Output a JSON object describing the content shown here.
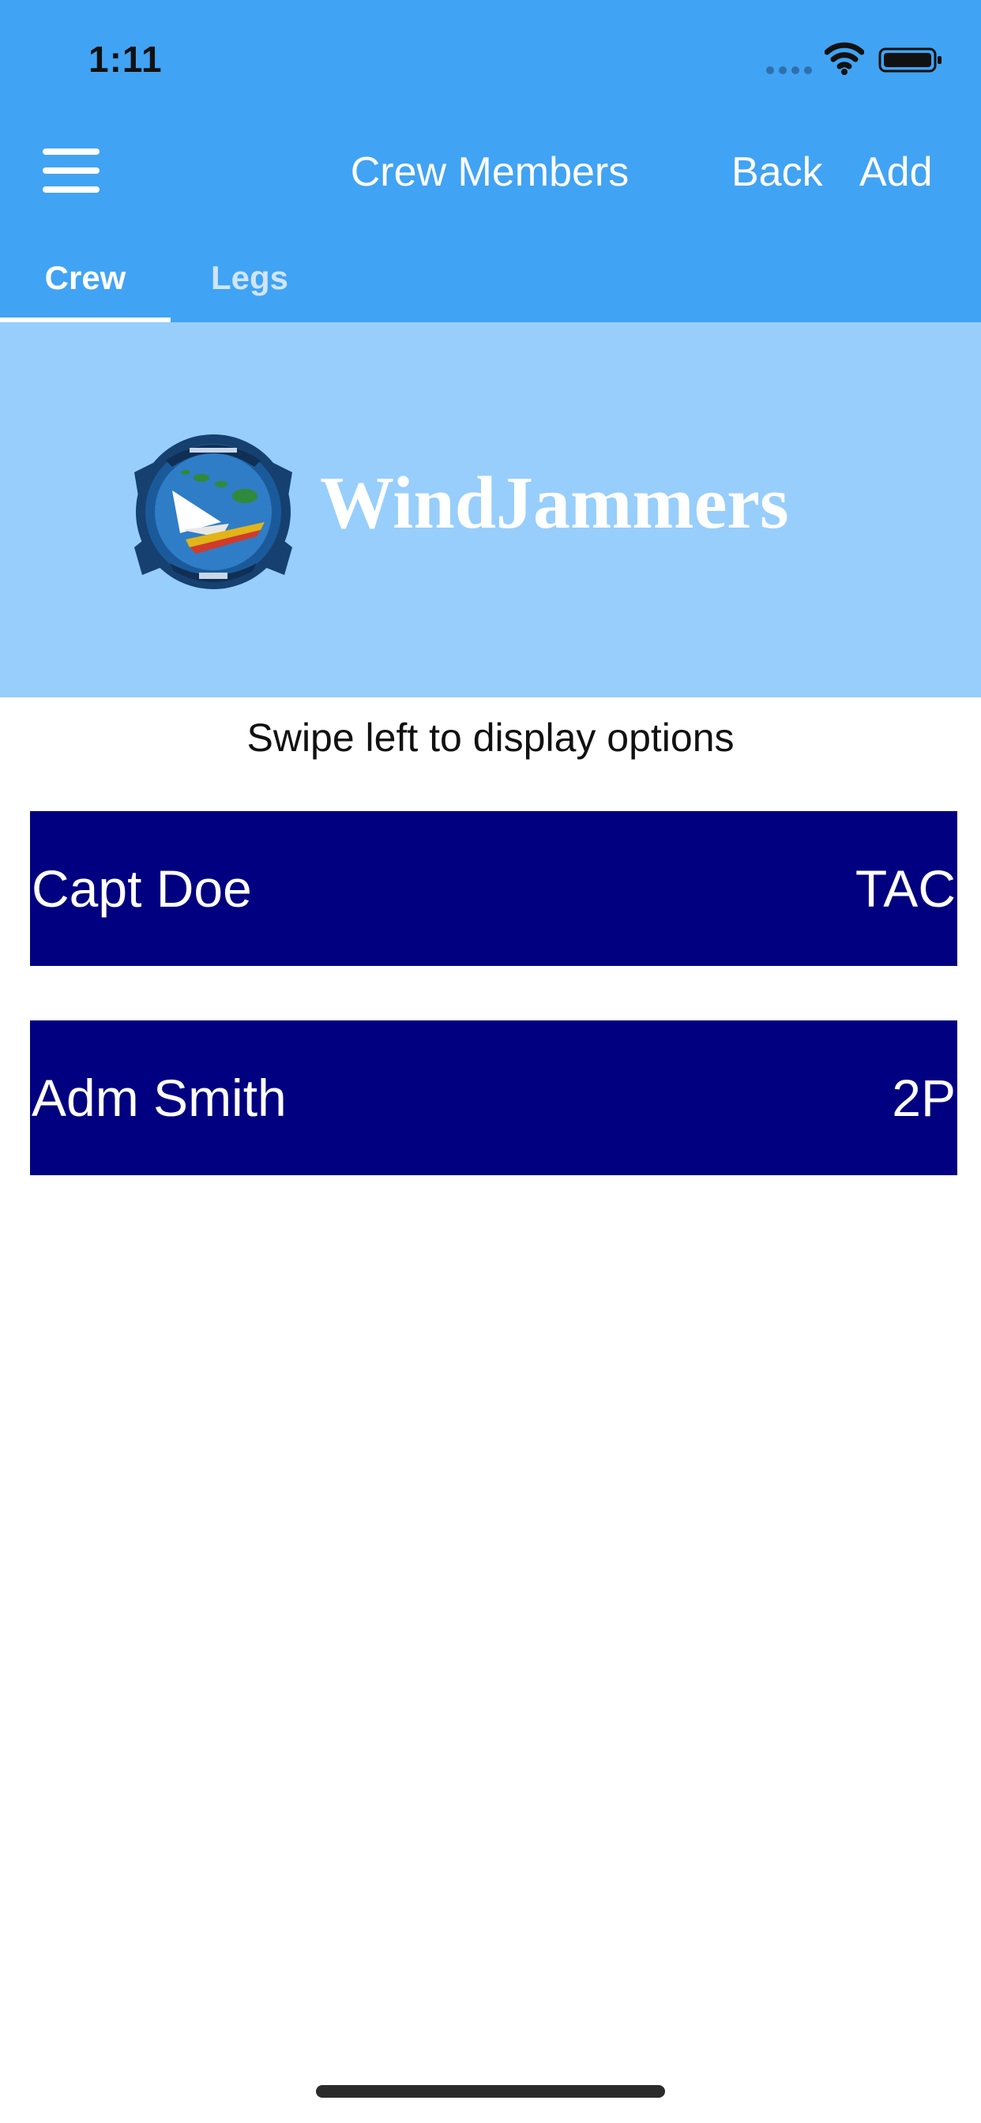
{
  "status_bar": {
    "time": "1:11"
  },
  "nav": {
    "title": "Crew Members",
    "back_label": "Back",
    "add_label": "Add"
  },
  "tabs": [
    {
      "label": "Crew",
      "selected": true
    },
    {
      "label": "Legs",
      "selected": false
    }
  ],
  "banner": {
    "logo_text": "WindJammers"
  },
  "hint": "Swipe left to display options",
  "crew": [
    {
      "name": "Capt Doe",
      "role": "TAC"
    },
    {
      "name": "Adm Smith",
      "role": "2P"
    }
  ],
  "colors": {
    "header": "#41a3f3",
    "banner": "#97cefc",
    "row": "#000080"
  }
}
